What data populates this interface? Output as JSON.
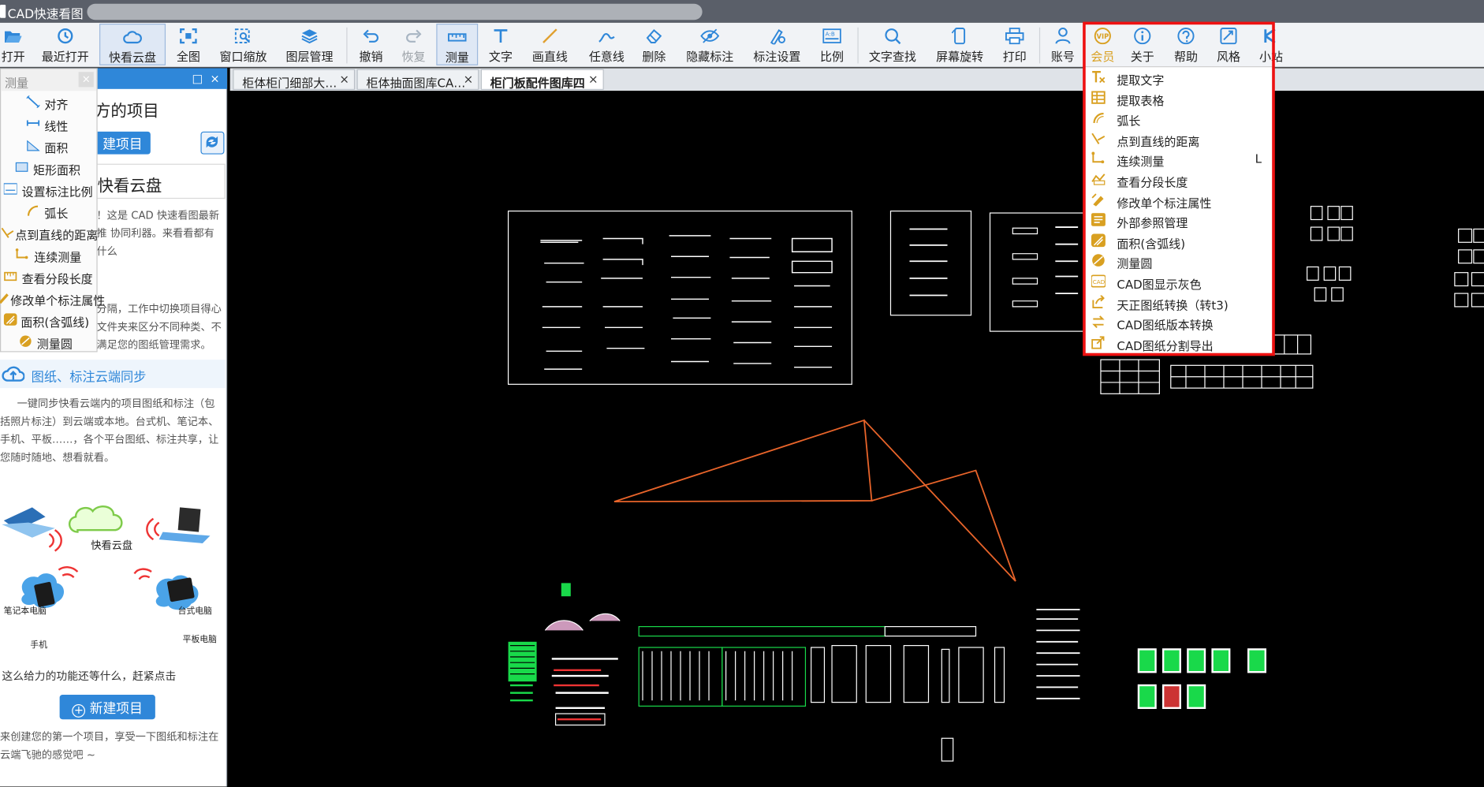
{
  "window": {
    "title": "CAD快速看图"
  },
  "toolbar": {
    "items": [
      {
        "label": "打开",
        "icon": "folder-open-icon"
      },
      {
        "label": "最近打开",
        "icon": "history-icon"
      },
      {
        "label": "快看云盘",
        "icon": "cloud-icon"
      },
      {
        "label": "全图",
        "icon": "fit-all-icon"
      },
      {
        "label": "窗口缩放",
        "icon": "window-zoom-icon"
      },
      {
        "label": "图层管理",
        "icon": "layers-icon"
      },
      {
        "label": "撤销",
        "icon": "undo-icon"
      },
      {
        "label": "恢复",
        "icon": "redo-icon"
      },
      {
        "label": "测量",
        "icon": "measure-icon"
      },
      {
        "label": "文字",
        "icon": "text-icon"
      },
      {
        "label": "画直线",
        "icon": "line-icon"
      },
      {
        "label": "任意线",
        "icon": "freehand-icon"
      },
      {
        "label": "删除",
        "icon": "eraser-icon"
      },
      {
        "label": "隐藏标注",
        "icon": "eye-icon"
      },
      {
        "label": "标注设置",
        "icon": "annotation-settings-icon"
      },
      {
        "label": "比例",
        "icon": "scale-icon"
      },
      {
        "label": "文字查找",
        "icon": "text-search-icon"
      },
      {
        "label": "屏幕旋转",
        "icon": "rotate-screen-icon"
      },
      {
        "label": "打印",
        "icon": "printer-icon"
      },
      {
        "label": "账号",
        "icon": "user-icon"
      },
      {
        "label": "会员",
        "icon": "vip-icon"
      },
      {
        "label": "关于",
        "icon": "info-icon"
      },
      {
        "label": "帮助",
        "icon": "help-icon"
      },
      {
        "label": "风格",
        "icon": "style-icon"
      },
      {
        "label": "小站",
        "icon": "station-icon"
      }
    ]
  },
  "measure_menu": {
    "header": "测量",
    "close": "×",
    "items": [
      "对齐",
      "线性",
      "面积",
      "矩形面积",
      "设置标注比例",
      "弧长",
      "点到直线的距离",
      "连续测量",
      "查看分段长度",
      "修改单个标注属性",
      "面积(含弧线)",
      "测量圆"
    ]
  },
  "left_panel": {
    "header_controls": [
      "□",
      "×"
    ],
    "heading_projects": "方的项目",
    "new_project_top": "建项目",
    "heading_cloud": "快看云盘",
    "text_intro": "！这是 CAD 快速看图最新推 协同利器。来看看都有什么",
    "text_folders": "分隔，工作中切换项目得心 文件夹来区分不同种类、不 满足您的图纸管理需求。",
    "sync_title": "图纸、标注云端同步",
    "sync_desc": "一键同步快看云端内的项目图纸和标注（包括照片标注）到云端或本地。台式机、笔记本、手机、平板……，各个平台图纸、标注共享，让您随时随地、想看就看。",
    "devices": {
      "laptop": "笔记本电脑",
      "cloud": "快看云盘",
      "desktop": "台式电脑",
      "phone": "手机",
      "tablet": "平板电脑"
    },
    "cta_text": "这么给力的功能还等什么，赶紧点击",
    "new_project_button": "新建项目",
    "footer_text": "来创建您的第一个项目，享受一下图纸和标注在云端飞驰的感觉吧 ~"
  },
  "tabs": [
    {
      "label": "柜体柜门细部大…",
      "close": "×"
    },
    {
      "label": "柜体抽面图库CA…",
      "close": "×"
    },
    {
      "label": "柜门板配件图库四",
      "close": "×"
    }
  ],
  "vip_menu": {
    "items": [
      {
        "label": "提取文字"
      },
      {
        "label": "提取表格"
      },
      {
        "label": "弧长"
      },
      {
        "label": "点到直线的距离"
      },
      {
        "label": "连续测量",
        "shortcut": "L"
      },
      {
        "label": "查看分段长度"
      },
      {
        "label": "修改单个标注属性"
      },
      {
        "label": "外部参照管理"
      },
      {
        "label": "面积(含弧线)"
      },
      {
        "label": "测量圆"
      },
      {
        "label": "CAD图显示灰色"
      },
      {
        "label": "天正图纸转换（转t3)"
      },
      {
        "label": "CAD图纸版本转换"
      },
      {
        "label": "CAD图纸分割导出"
      }
    ]
  },
  "colors": {
    "accent": "#2f87d9",
    "highlight": "#e11111",
    "vip_gold": "#d9a021",
    "drawing_orange": "#e8642a",
    "drawing_green": "#19d94a"
  }
}
